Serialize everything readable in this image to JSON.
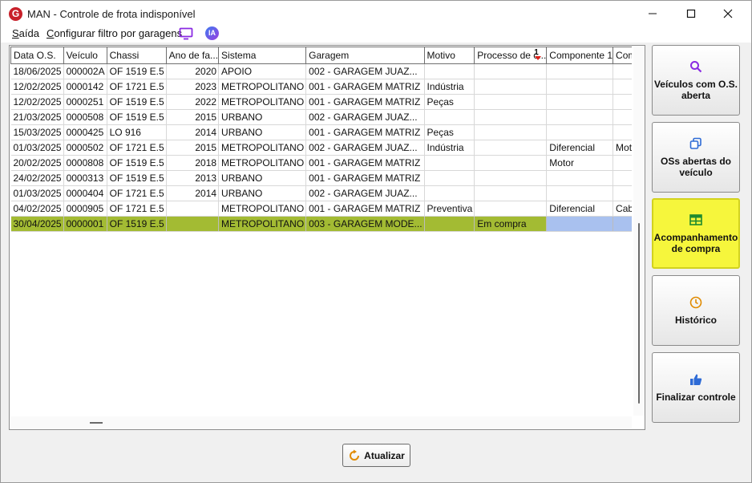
{
  "window": {
    "title": "MAN - Controle de frota indisponível",
    "app_icon_letter": "G"
  },
  "menu": {
    "exit": "Saída",
    "exit_hotkey": "S",
    "exit_rest": "aída",
    "filter": "Configurar filtro por garagens",
    "filter_hotkey": "C",
    "filter_rest": "onfigurar filtro por garagens",
    "ia_label": "IA"
  },
  "grid": {
    "columns": [
      "Data O.S.",
      "Veículo",
      "Chassi",
      "Ano de fa...",
      "Sistema",
      "Garagem",
      "Motivo",
      "Processo de c...",
      "Componente 1",
      "Component"
    ],
    "sort_column_index": 7,
    "sort_order": "1",
    "rows": [
      [
        "18/06/2025",
        "000002A",
        "OF 1519 E.5",
        "2020",
        "APOIO",
        "002 - GARAGEM JUAZ...",
        "",
        "",
        "",
        ""
      ],
      [
        "12/02/2025",
        "0000142",
        "OF 1721 E.5",
        "2023",
        "METROPOLITANO",
        "001 - GARAGEM MATRIZ",
        "Indústria",
        "",
        "",
        ""
      ],
      [
        "12/02/2025",
        "0000251",
        "OF 1519 E.5",
        "2022",
        "METROPOLITANO",
        "001 - GARAGEM MATRIZ",
        "Peças",
        "",
        "",
        ""
      ],
      [
        "21/03/2025",
        "0000508",
        "OF 1519 E.5",
        "2015",
        "URBANO",
        "002 - GARAGEM JUAZ...",
        "",
        "",
        "",
        ""
      ],
      [
        "15/03/2025",
        "0000425",
        "LO 916",
        "2014",
        "URBANO",
        "001 - GARAGEM MATRIZ",
        "Peças",
        "",
        "",
        ""
      ],
      [
        "01/03/2025",
        "0000502",
        "OF 1721 E.5",
        "2015",
        "METROPOLITANO",
        "002 - GARAGEM JUAZ...",
        "Indústria",
        "",
        "Diferencial",
        "Motor"
      ],
      [
        "20/02/2025",
        "0000808",
        "OF 1519 E.5",
        "2018",
        "METROPOLITANO",
        "001 - GARAGEM MATRIZ",
        "",
        "",
        "Motor",
        ""
      ],
      [
        "24/02/2025",
        "0000313",
        "OF 1519 E.5",
        "2013",
        "URBANO",
        "001 - GARAGEM MATRIZ",
        "",
        "",
        "",
        ""
      ],
      [
        "01/03/2025",
        "0000404",
        "OF 1721 E.5",
        "2014",
        "URBANO",
        "002 - GARAGEM JUAZ...",
        "",
        "",
        "",
        ""
      ],
      [
        "04/02/2025",
        "0000905",
        "OF 1721 E.5",
        "",
        "METROPOLITANO",
        "001 - GARAGEM MATRIZ",
        "Preventiva",
        "",
        "Diferencial",
        "Cabeçote"
      ],
      [
        "30/04/2025",
        "0000001",
        "OF 1519 E.5",
        "",
        "METROPOLITANO",
        "003 - GARAGEM MODE...",
        "",
        "Em compra",
        "",
        ""
      ]
    ],
    "selected_row_index": 10
  },
  "side_buttons": [
    {
      "label_1": "Veículos com O.S.",
      "label_2": "aberta",
      "icon": "search-icon",
      "active": false
    },
    {
      "label_1": "OSs abertas do",
      "label_2": "veículo",
      "icon": "copy-icon",
      "active": false
    },
    {
      "label_1": "Acompanhamento",
      "label_2": "de compra",
      "icon": "table-icon",
      "active": true
    },
    {
      "label_1": "Histórico",
      "label_2": "",
      "icon": "clock-icon",
      "active": false
    },
    {
      "label_1": "Finalizar controle",
      "label_2": "",
      "icon": "thumbs-up-icon",
      "active": false
    }
  ],
  "refresh_button": {
    "label": "Atualizar"
  },
  "colors": {
    "selected_row": "#a3bb33",
    "selected_cell": "#a9c1ef",
    "active_button": "#f6f63c",
    "accent_icon": "#8a2be2",
    "brand_red": "#c8202a"
  }
}
